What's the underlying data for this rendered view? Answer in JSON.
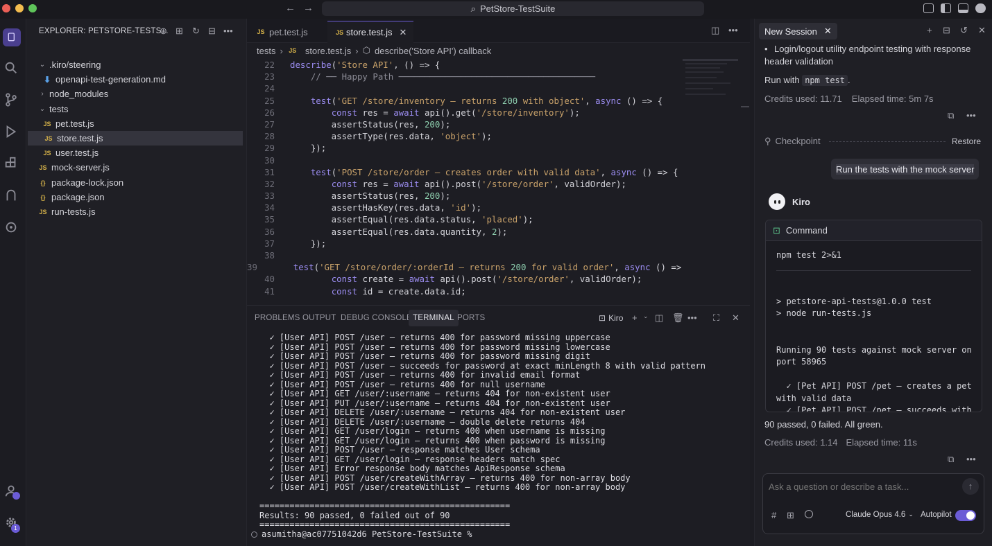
{
  "window": {
    "title": "PetStore-TestSuite"
  },
  "explorer": {
    "header": "EXPLORER: PETSTORE-TESTS...",
    "tree": [
      {
        "label": ".kiro/steering",
        "type": "folder",
        "open": true,
        "depth": 0
      },
      {
        "label": "openapi-test-generation.md",
        "type": "md",
        "depth": 1
      },
      {
        "label": "node_modules",
        "type": "folder",
        "open": false,
        "depth": 0
      },
      {
        "label": "tests",
        "type": "folder",
        "open": true,
        "depth": 0
      },
      {
        "label": "pet.test.js",
        "type": "js",
        "depth": 1
      },
      {
        "label": "store.test.js",
        "type": "js",
        "depth": 1,
        "selected": true
      },
      {
        "label": "user.test.js",
        "type": "js",
        "depth": 1
      },
      {
        "label": "mock-server.js",
        "type": "js",
        "depth": 0
      },
      {
        "label": "package-lock.json",
        "type": "json",
        "depth": 0
      },
      {
        "label": "package.json",
        "type": "json",
        "depth": 0
      },
      {
        "label": "run-tests.js",
        "type": "js",
        "depth": 0
      }
    ]
  },
  "editor": {
    "tabs": [
      {
        "label": "pet.test.js",
        "active": false
      },
      {
        "label": "store.test.js",
        "active": true
      }
    ],
    "breadcrumb": [
      "tests",
      "store.test.js",
      "describe('Store API') callback"
    ],
    "lines": [
      {
        "n": "22",
        "code": "describe('Store API', () => {"
      },
      {
        "n": "23",
        "code": "    // ── Happy Path ──────────────────────────────────────"
      },
      {
        "n": "24",
        "code": ""
      },
      {
        "n": "25",
        "code": "    test('GET /store/inventory — returns 200 with object', async () => {"
      },
      {
        "n": "26",
        "code": "        const res = await api().get('/store/inventory');"
      },
      {
        "n": "27",
        "code": "        assertStatus(res, 200);"
      },
      {
        "n": "28",
        "code": "        assertType(res.data, 'object');"
      },
      {
        "n": "29",
        "code": "    });"
      },
      {
        "n": "30",
        "code": ""
      },
      {
        "n": "31",
        "code": "    test('POST /store/order — creates order with valid data', async () => {"
      },
      {
        "n": "32",
        "code": "        const res = await api().post('/store/order', validOrder);"
      },
      {
        "n": "33",
        "code": "        assertStatus(res, 200);"
      },
      {
        "n": "34",
        "code": "        assertHasKey(res.data, 'id');"
      },
      {
        "n": "35",
        "code": "        assertEqual(res.data.status, 'placed');"
      },
      {
        "n": "36",
        "code": "        assertEqual(res.data.quantity, 2);"
      },
      {
        "n": "37",
        "code": "    });"
      },
      {
        "n": "38",
        "code": ""
      },
      {
        "n": "39",
        "code": "    test('GET /store/order/:orderId — returns 200 for valid order', async () => {"
      },
      {
        "n": "40",
        "code": "        const create = await api().post('/store/order', validOrder);"
      },
      {
        "n": "41",
        "code": "        const id = create.data.id;"
      }
    ]
  },
  "panel": {
    "tabs": [
      "PROBLEMS",
      "OUTPUT",
      "DEBUG CONSOLE",
      "TERMINAL",
      "PORTS"
    ],
    "active_tab": "TERMINAL",
    "terminal_name": "Kiro",
    "lines": [
      "  ✓ [User API] POST /user — returns 400 for password missing uppercase",
      "  ✓ [User API] POST /user — returns 400 for password missing lowercase",
      "  ✓ [User API] POST /user — returns 400 for password missing digit",
      "  ✓ [User API] POST /user — succeeds for password at exact minLength 8 with valid pattern",
      "  ✓ [User API] POST /user — returns 400 for invalid email format",
      "  ✓ [User API] POST /user — returns 400 for null username",
      "  ✓ [User API] GET /user/:username — returns 404 for non-existent user",
      "  ✓ [User API] PUT /user/:username — returns 404 for non-existent user",
      "  ✓ [User API] DELETE /user/:username — returns 404 for non-existent user",
      "  ✓ [User API] DELETE /user/:username — double delete returns 404",
      "  ✓ [User API] GET /user/login — returns 400 when username is missing",
      "  ✓ [User API] GET /user/login — returns 400 when password is missing",
      "  ✓ [User API] POST /user — response matches User schema",
      "  ✓ [User API] GET /user/login — response headers match spec",
      "  ✓ [User API] Error response body matches ApiResponse schema",
      "  ✓ [User API] POST /user/createWithArray — returns 400 for non-array body",
      "  ✓ [User API] POST /user/createWithList — returns 400 for non-array body",
      "",
      "==================================================",
      "Results: 90 passed, 0 failed out of 90",
      "=================================================="
    ],
    "prompt": "asumitha@ac07751042d6 PetStore-TestSuite %"
  },
  "chat": {
    "tab": "New Session",
    "bullet": "Login/logout utility endpoint testing with response header validation",
    "run_prefix": "Run with",
    "run_code": "npm test",
    "run_suffix": ".",
    "credits1": "Credits used: 11.71",
    "elapsed1": "Elapsed time: 5m 7s",
    "checkpoint": "Checkpoint",
    "restore": "Restore",
    "user_msg": "Run the tests with the mock server",
    "agent": "Kiro",
    "command_label": "Command",
    "command": "npm test 2>&1",
    "output": [
      "> petstore-api-tests@1.0.0 test",
      "> node run-tests.js",
      "",
      "",
      "Running 90 tests against mock server on",
      "port 58965",
      "",
      "  ✓ [Pet API] POST /pet — creates a pet",
      "with valid data",
      "  ✓ [Pet API] POST /pet — succeeds with"
    ],
    "result": "90 passed, 0 failed. All green.",
    "credits2": "Credits used: 1.14",
    "elapsed2": "Elapsed time: 11s",
    "input_placeholder": "Ask a question or describe a task...",
    "model": "Claude Opus 4.6",
    "autopilot": "Autopilot",
    "autopilot_on": true
  }
}
